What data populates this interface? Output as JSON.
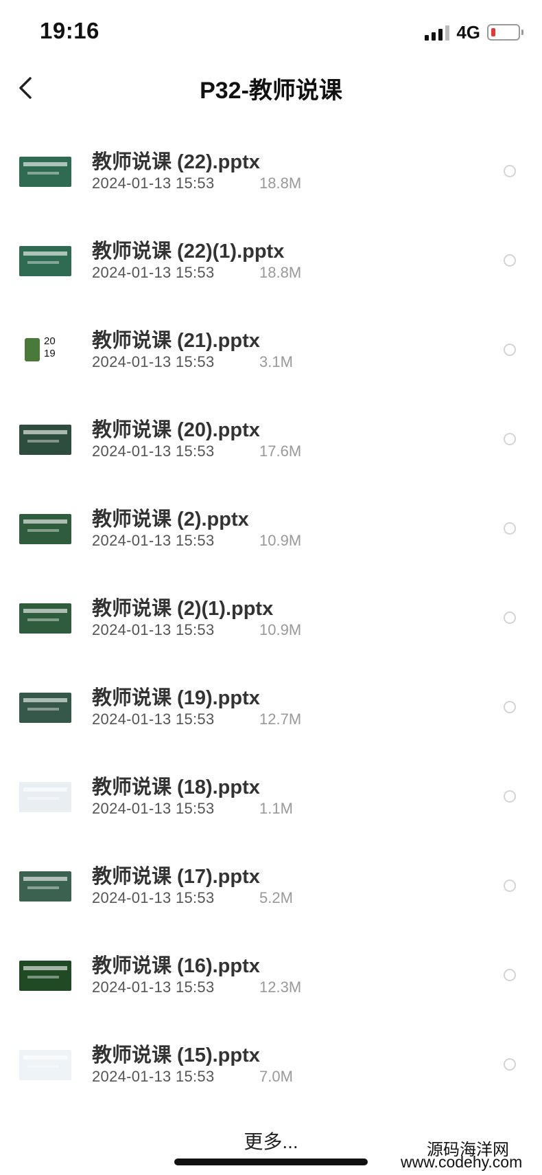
{
  "status": {
    "time": "19:16",
    "network": "4G"
  },
  "nav": {
    "title": "P32-教师说课"
  },
  "files": [
    {
      "name": "教师说课 (22).pptx",
      "date": "2024-01-13 15:53",
      "size": "18.8M",
      "thumb_color": "#2f6b52"
    },
    {
      "name": "教师说课 (22)(1).pptx",
      "date": "2024-01-13 15:53",
      "size": "18.8M",
      "thumb_color": "#2f6b52"
    },
    {
      "name": "教师说课 (21).pptx",
      "date": "2024-01-13 15:53",
      "size": "3.1M",
      "thumb_color": "#ffffff",
      "thumb_text": "20\n19"
    },
    {
      "name": "教师说课 (20).pptx",
      "date": "2024-01-13 15:53",
      "size": "17.6M",
      "thumb_color": "#2d4d3e"
    },
    {
      "name": "教师说课 (2).pptx",
      "date": "2024-01-13 15:53",
      "size": "10.9M",
      "thumb_color": "#2e5c3c"
    },
    {
      "name": "教师说课 (2)(1).pptx",
      "date": "2024-01-13 15:53",
      "size": "10.9M",
      "thumb_color": "#2e5c3c"
    },
    {
      "name": "教师说课 (19).pptx",
      "date": "2024-01-13 15:53",
      "size": "12.7M",
      "thumb_color": "#35584a"
    },
    {
      "name": "教师说课 (18).pptx",
      "date": "2024-01-13 15:53",
      "size": "1.1M",
      "thumb_color": "#e9eef2"
    },
    {
      "name": "教师说课 (17).pptx",
      "date": "2024-01-13 15:53",
      "size": "5.2M",
      "thumb_color": "#3b6150"
    },
    {
      "name": "教师说课 (16).pptx",
      "date": "2024-01-13 15:53",
      "size": "12.3M",
      "thumb_color": "#1f4a24"
    },
    {
      "name": "教师说课 (15).pptx",
      "date": "2024-01-13 15:53",
      "size": "7.0M",
      "thumb_color": "#eef3f8"
    }
  ],
  "more_label": "更多...",
  "watermark": {
    "line1": "源码海洋网",
    "line2": "www.codehy.com"
  }
}
